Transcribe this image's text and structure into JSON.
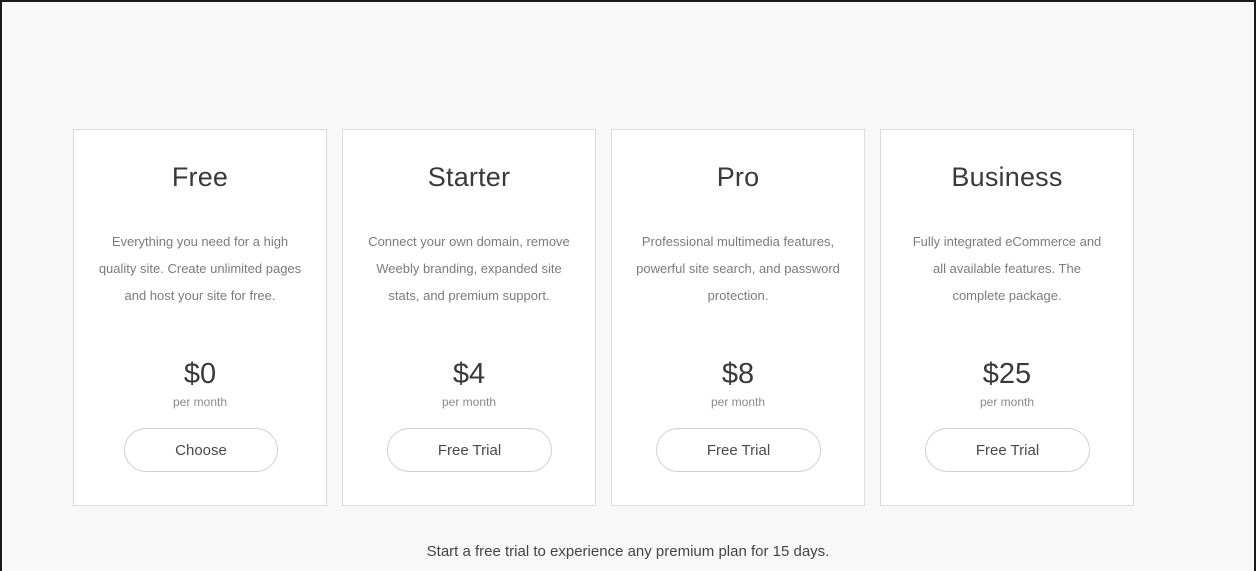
{
  "plans": [
    {
      "name": "Free",
      "description": "Everything you need for a high quality site. Create unlimited pages and host your site for free.",
      "price": "$0",
      "period": "per month",
      "button_label": "Choose"
    },
    {
      "name": "Starter",
      "description": "Connect your own domain, remove Weebly branding, expanded site stats, and premium support.",
      "price": "$4",
      "period": "per month",
      "button_label": "Free Trial"
    },
    {
      "name": "Pro",
      "description": "Professional multimedia features, powerful site search, and password protection.",
      "price": "$8",
      "period": "per month",
      "button_label": "Free Trial"
    },
    {
      "name": "Business",
      "description": "Fully integrated eCommerce and all available features. The complete package.",
      "price": "$25",
      "period": "per month",
      "button_label": "Free Trial"
    }
  ],
  "footer": {
    "note": "Start a free trial to experience any premium plan for 15 days."
  },
  "colors": {
    "page_background": "#f8f8f8",
    "card_background": "#ffffff",
    "card_border": "#dcdcdc",
    "button_border": "#cfcfcf"
  }
}
